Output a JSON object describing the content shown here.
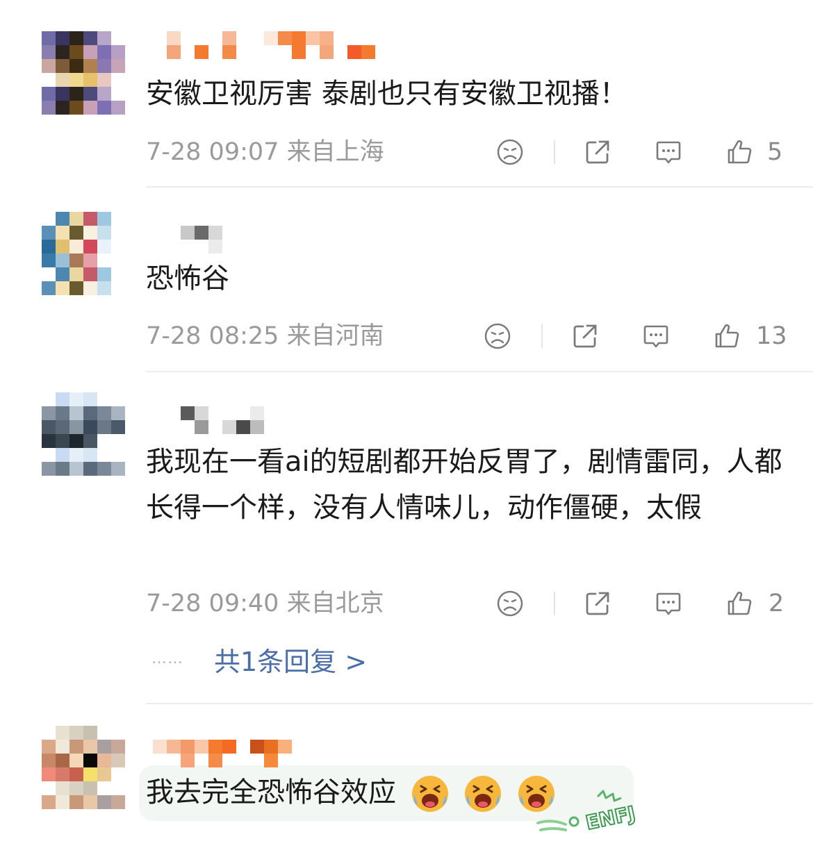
{
  "colors": {
    "text": "#1a1a1a",
    "meta": "#9a9a9a",
    "link": "#4b6ea8",
    "icon": "#8a8a8a"
  },
  "comments": [
    {
      "content": "安徽卫视厉害 泰剧也只有安徽卫视播！",
      "time": "7-28 09:07",
      "location": "来自上海",
      "likes": "5"
    },
    {
      "content": "恐怖谷",
      "time": "7-28 08:25",
      "location": "来自河南",
      "likes": "13"
    },
    {
      "content": "我现在一看ai的短剧都开始反胃了，剧情雷同，人都长得一个样，没有人情味儿，动作僵硬，太假",
      "time": "7-28 09:40",
      "location": "来自北京",
      "likes": "2",
      "replies": {
        "dots": "……",
        "label": "共1条回复 >"
      }
    },
    {
      "content": "我去完全恐怖谷效应",
      "emoji": [
        "crying-face-emoji",
        "crying-face-emoji",
        "crying-face-emoji"
      ],
      "sticker": "ENFJ"
    }
  ],
  "icons": [
    "sad-face-icon",
    "share-icon",
    "comment-icon",
    "thumbs-up-icon"
  ]
}
